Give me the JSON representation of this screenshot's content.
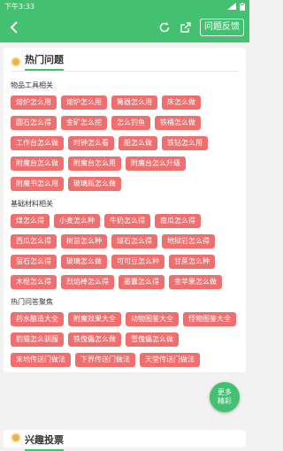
{
  "statusbar": {
    "time": "下午3:33",
    "battery": "▮"
  },
  "appbar": {
    "feedback_label": "问题反馈"
  },
  "hot_questions": {
    "title": "热门问题",
    "groups": [
      {
        "title": "物品工具相关",
        "tags": [
          "熔炉怎么用",
          "熔炉怎么用",
          "篝器怎么用",
          "床怎么做",
          "圆石怎么得",
          "金矿怎么挖",
          "怎么钓鱼",
          "铁桶怎么做",
          "工作台怎么做",
          "时钟怎么看",
          "船怎么做",
          "铁钻怎么用",
          "附魔台怎么做",
          "附魔台怎么用",
          "附魔台怎么升级",
          "附魔书怎么用",
          "玻璃瓶怎么做"
        ]
      },
      {
        "title": "基础材料相关",
        "tags": [
          "煤怎么得",
          "小麦怎么种",
          "牛奶怎么得",
          "南瓜怎么得",
          "西瓜怎么得",
          "树苗怎么种",
          "燧石怎么得",
          "地狱岩怎么得",
          "萤石怎么得",
          "玻璃怎么做",
          "可可豆怎么种",
          "甘蔗怎么种",
          "木棍怎么得",
          "烈焰棒怎么得",
          "墨囊怎么得",
          "金苹果怎么做"
        ]
      },
      {
        "title": "热门问答聚焦",
        "tags": [
          "药水酿造大全",
          "附魔效果大全",
          "动物图鉴大全",
          "怪物图鉴大全",
          "豹猫怎么驯服",
          "铁傀儡怎么做",
          "雪傀儡怎么做",
          "末地传送门做法",
          "下界传送门做法",
          "天堂传送门做法"
        ]
      }
    ]
  },
  "float_button": {
    "line1": "更多",
    "line2": "精彩"
  },
  "bottom_section": {
    "title": "兴趣投票"
  },
  "colors": {
    "primary": "#43c171",
    "tag": "#ef6e6e",
    "accent": "#e6b34d"
  }
}
